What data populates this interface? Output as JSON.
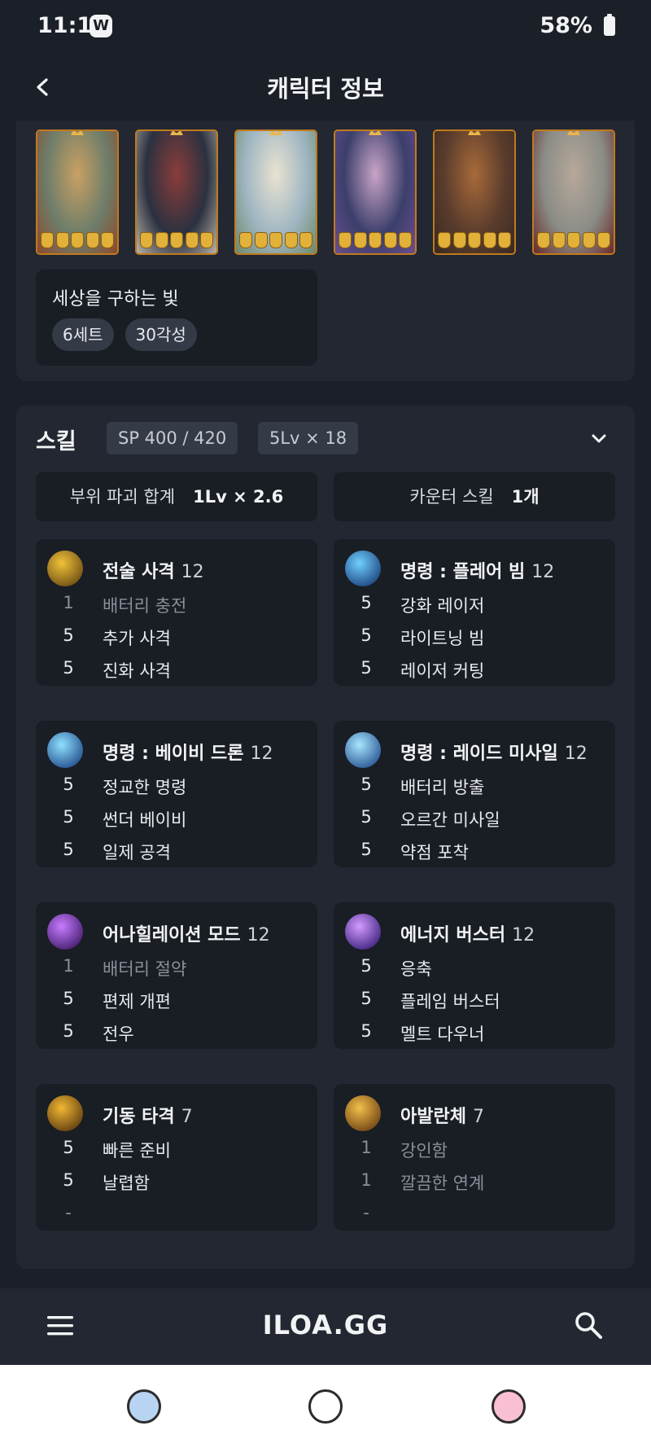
{
  "status_bar": {
    "time": "11:12",
    "app_badge": "W",
    "battery": "58%"
  },
  "header": {
    "title": "캐릭터 정보",
    "back_icon": "chevron-left-icon"
  },
  "cards": {
    "items": [
      {
        "art_colors": [
          "#6d7d6a",
          "#c9a062",
          "#8d4a2c"
        ]
      },
      {
        "art_colors": [
          "#2b3140",
          "#8a3d3a",
          "#b9b2a6"
        ]
      },
      {
        "art_colors": [
          "#9fb6c2",
          "#e9e2d1",
          "#6f8a6a"
        ]
      },
      {
        "art_colors": [
          "#3b3f6b",
          "#c9a4c7",
          "#6a4d8f"
        ]
      },
      {
        "art_colors": [
          "#5a3c2c",
          "#a86a3a",
          "#3a2a22"
        ]
      },
      {
        "art_colors": [
          "#8a8c86",
          "#b7a89a",
          "#6b2a2a"
        ]
      }
    ],
    "set": {
      "name": "세상을 구하는 빛",
      "chips": [
        "6세트",
        "30각성"
      ]
    }
  },
  "skills": {
    "label": "스킬",
    "sp": "SP 400 / 420",
    "lv_summary": "5Lv × 18",
    "expand_icon": "chevron-down-icon",
    "stats": [
      {
        "label": "부위 파괴 합계",
        "value": "1Lv × 2.6"
      },
      {
        "label": "카운터 스킬",
        "value": "1개"
      }
    ],
    "items": [
      {
        "name": "전술 사격",
        "level": "12",
        "icon_colors": [
          "#f0c23a",
          "#6a4a12"
        ],
        "tripods": [
          {
            "lv": "1",
            "name": "배터리 충전",
            "dim": true
          },
          {
            "lv": "5",
            "name": "추가 사격"
          },
          {
            "lv": "5",
            "name": "진화 사격"
          }
        ]
      },
      {
        "name": "명령 : 플레어 빔",
        "level": "12",
        "icon_colors": [
          "#6fd0ff",
          "#1a3f7a"
        ],
        "tripods": [
          {
            "lv": "5",
            "name": "강화 레이저"
          },
          {
            "lv": "5",
            "name": "라이트닝 빔"
          },
          {
            "lv": "5",
            "name": "레이저 커팅"
          }
        ]
      },
      {
        "name": "명령 : 베이비 드론",
        "level": "12",
        "icon_colors": [
          "#8fe0ff",
          "#1f4a8a"
        ],
        "tripods": [
          {
            "lv": "5",
            "name": "정교한 명령"
          },
          {
            "lv": "5",
            "name": "썬더 베이비"
          },
          {
            "lv": "5",
            "name": "일제 공격"
          }
        ]
      },
      {
        "name": "명령 : 레이드 미사일",
        "level": "12",
        "icon_colors": [
          "#a8e6ff",
          "#24508f"
        ],
        "tripods": [
          {
            "lv": "5",
            "name": "배터리 방출"
          },
          {
            "lv": "5",
            "name": "오르간 미사일"
          },
          {
            "lv": "5",
            "name": "약점 포착"
          }
        ]
      },
      {
        "name": "어나힐레이션 모드",
        "level": "12",
        "icon_colors": [
          "#c77bff",
          "#3f1a6a"
        ],
        "tripods": [
          {
            "lv": "1",
            "name": "배터리 절약",
            "dim": true
          },
          {
            "lv": "5",
            "name": "편제 개편"
          },
          {
            "lv": "5",
            "name": "전우"
          }
        ]
      },
      {
        "name": "에너지 버스터",
        "level": "12",
        "icon_colors": [
          "#d39bff",
          "#3a1f7a"
        ],
        "tripods": [
          {
            "lv": "5",
            "name": "응축"
          },
          {
            "lv": "5",
            "name": "플레임 버스터"
          },
          {
            "lv": "5",
            "name": "멜트 다우너"
          }
        ]
      },
      {
        "name": "기동 타격",
        "level": "7",
        "icon_colors": [
          "#f2b732",
          "#5a3a10"
        ],
        "tripods": [
          {
            "lv": "5",
            "name": "빠른 준비"
          },
          {
            "lv": "5",
            "name": "날렵함"
          },
          {
            "lv": "-",
            "name": "",
            "dim": true
          }
        ]
      },
      {
        "name": "아발란체",
        "level": "7",
        "icon_colors": [
          "#f3c04a",
          "#6a3e12"
        ],
        "tripods": [
          {
            "lv": "1",
            "name": "강인함",
            "dim": true
          },
          {
            "lv": "1",
            "name": "깔끔한 연계",
            "dim": true
          },
          {
            "lv": "-",
            "name": "",
            "dim": true
          }
        ]
      }
    ]
  },
  "app_bar": {
    "brand": "ILOA.GG",
    "menu_icon": "hamburger-menu-icon",
    "search_icon": "search-icon"
  },
  "system_nav": {
    "buttons": [
      {
        "name": "recents-button",
        "color": "#b9d3f2"
      },
      {
        "name": "home-button",
        "color": "#ffffff"
      },
      {
        "name": "back-button",
        "color": "#f9bfd2"
      }
    ]
  }
}
